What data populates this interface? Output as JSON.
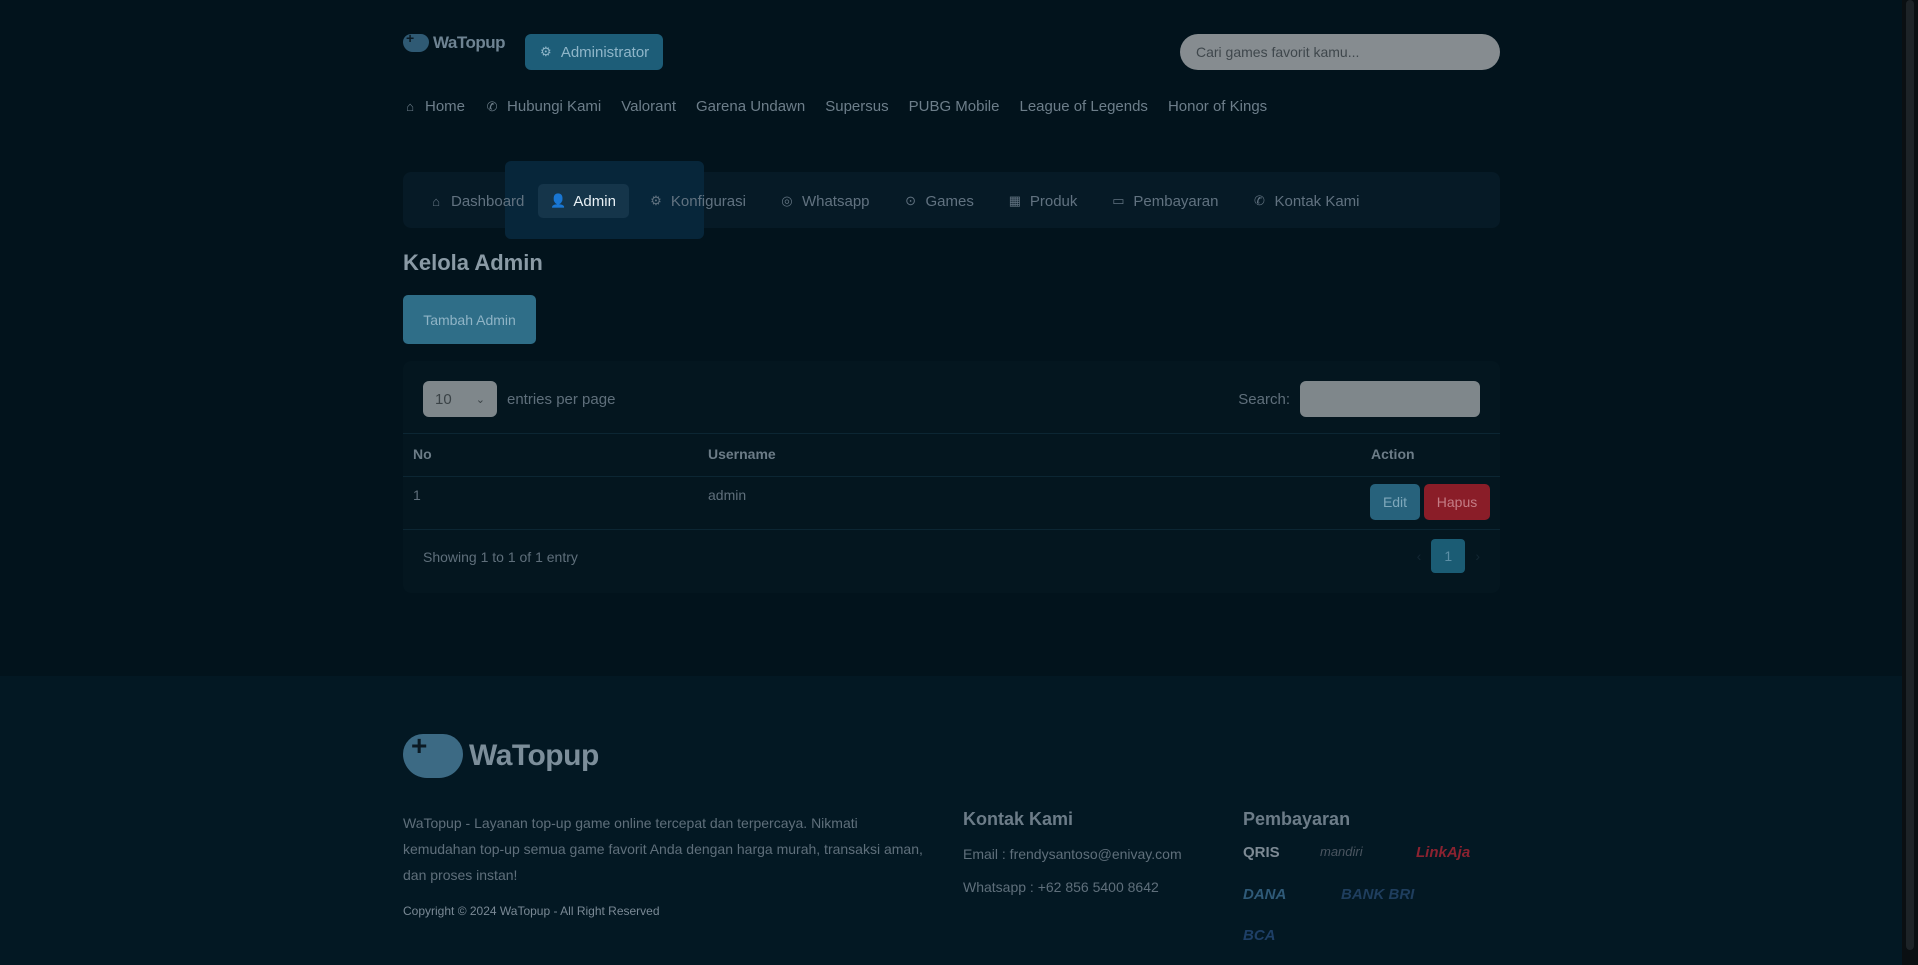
{
  "header": {
    "logo_text": "WaTopup",
    "admin_button": "Administrator",
    "search_placeholder": "Cari games favorit kamu..."
  },
  "main_nav": [
    {
      "label": "Home",
      "icon": "home-icon"
    },
    {
      "label": "Hubungi Kami",
      "icon": "phone-icon"
    },
    {
      "label": "Valorant"
    },
    {
      "label": "Garena Undawn"
    },
    {
      "label": "Supersus"
    },
    {
      "label": "PUBG Mobile"
    },
    {
      "label": "League of Legends"
    },
    {
      "label": "Honor of Kings"
    }
  ],
  "admin_nav": [
    {
      "label": "Dashboard",
      "icon": "home-icon"
    },
    {
      "label": "Admin",
      "icon": "user-icon",
      "active": true
    },
    {
      "label": "Konfigurasi",
      "icon": "gear-icon"
    },
    {
      "label": "Whatsapp",
      "icon": "whatsapp-icon"
    },
    {
      "label": "Games",
      "icon": "gamepad-icon"
    },
    {
      "label": "Produk",
      "icon": "box-icon"
    },
    {
      "label": "Pembayaran",
      "icon": "credit-card-icon"
    },
    {
      "label": "Kontak Kami",
      "icon": "phone-icon"
    }
  ],
  "page": {
    "title": "Kelola Admin",
    "add_button": "Tambah Admin"
  },
  "table": {
    "length_value": "10",
    "length_label": "entries per page",
    "search_label": "Search:",
    "columns": [
      "No",
      "Username",
      "Action"
    ],
    "rows": [
      {
        "no": "1",
        "username": "admin",
        "edit": "Edit",
        "delete": "Hapus"
      }
    ],
    "info": "Showing 1 to 1 of 1 entry",
    "current_page": "1"
  },
  "footer": {
    "logo_text": "WaTopup",
    "description": "WaTopup - Layanan top-up game online tercepat dan terpercaya. Nikmati kemudahan top-up semua game favorit Anda dengan harga murah, transaksi aman, dan proses instan!",
    "copyright": "Copyright © 2024 WaTopup - All Right Reserved",
    "contact_title": "Kontak Kami",
    "email": "Email : frendysantoso@enivay.com",
    "whatsapp": "Whatsapp : +62 856 5400 8642",
    "payment_title": "Pembayaran",
    "payments": [
      "QRIS",
      "mandiri",
      "LinkAja",
      "DANA",
      "BANK BRI",
      "BCA"
    ]
  },
  "colors": {
    "accent": "#1d5d78",
    "danger": "#8a1d28",
    "background": "#02131c"
  }
}
